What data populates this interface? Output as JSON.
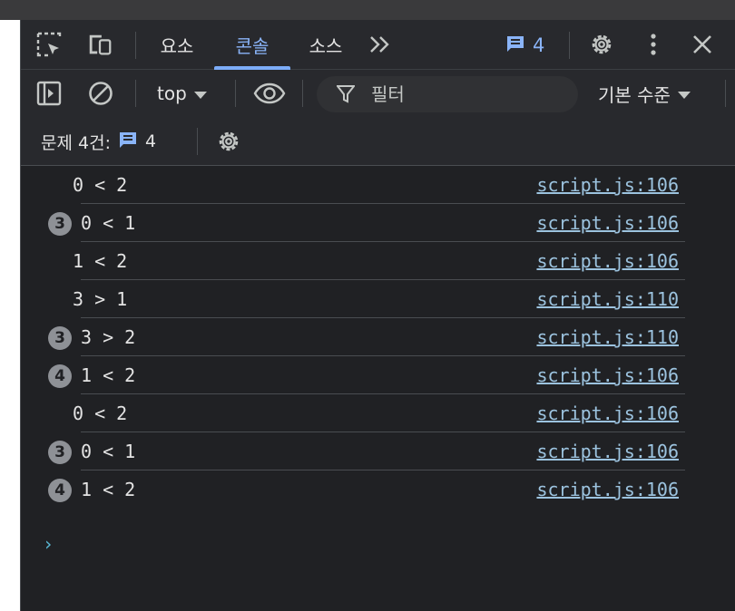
{
  "tabs": [
    {
      "label": "요소",
      "active": false
    },
    {
      "label": "콘솔",
      "active": true
    },
    {
      "label": "소스",
      "active": false
    }
  ],
  "toolbar": {
    "issues_count": "4",
    "icons": [
      "inspect-element-icon",
      "device-toolbar-icon",
      "more-tabs-icon",
      "message-icon",
      "settings-gear-icon",
      "more-vert-icon",
      "close-icon"
    ]
  },
  "console_controls": {
    "context": "top",
    "filter_placeholder": "필터",
    "levels": "기본 수준"
  },
  "issues_bar": {
    "label": "문제 4건:",
    "count": "4"
  },
  "logs": [
    {
      "badge": "",
      "message": "0 < 2",
      "source": "script.js:106"
    },
    {
      "badge": "3",
      "message": "0 < 1",
      "source": "script.js:106"
    },
    {
      "badge": "",
      "message": "1 < 2",
      "source": "script.js:106"
    },
    {
      "badge": "",
      "message": "3 > 1",
      "source": "script.js:110"
    },
    {
      "badge": "3",
      "message": "3 > 2",
      "source": "script.js:110"
    },
    {
      "badge": "4",
      "message": "1 < 2",
      "source": "script.js:106"
    },
    {
      "badge": "",
      "message": "0 < 2",
      "source": "script.js:106"
    },
    {
      "badge": "3",
      "message": "0 < 1",
      "source": "script.js:106"
    },
    {
      "badge": "4",
      "message": "1 < 2",
      "source": "script.js:106"
    }
  ],
  "prompt_symbol": "›",
  "colors": {
    "accent": "#8ab4f8",
    "link": "#9cc3df",
    "badge": "#8e9196",
    "background": "#202124"
  }
}
